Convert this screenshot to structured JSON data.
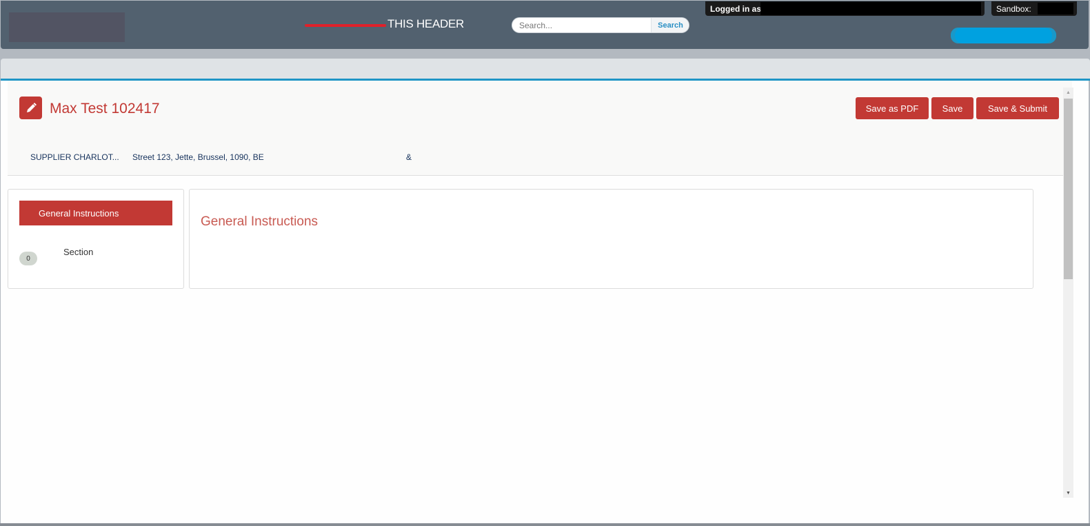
{
  "topbar": {
    "header_title": "THIS HEADER",
    "search": {
      "placeholder": "Search...",
      "button_label": "Search"
    },
    "login_label": "Logged in as",
    "sandbox_label": "Sandbox:"
  },
  "record": {
    "icon": "pencil-icon",
    "title": "Max Test 102417",
    "buttons": {
      "save_pdf": "Save as PDF",
      "save": "Save",
      "save_submit": "Save & Submit"
    },
    "supplier": "SUPPLIER CHARLOT...",
    "address": "Street 123, Jette, Brussel, 1090, BE",
    "extra": "&"
  },
  "nav": {
    "active_item": "General Instructions",
    "section_badge": "0",
    "section_label": "Section"
  },
  "main": {
    "heading": "General Instructions"
  },
  "colors": {
    "brand_red": "#c23934",
    "topbar": "#52616f",
    "accent_blue": "#1f95c6"
  }
}
